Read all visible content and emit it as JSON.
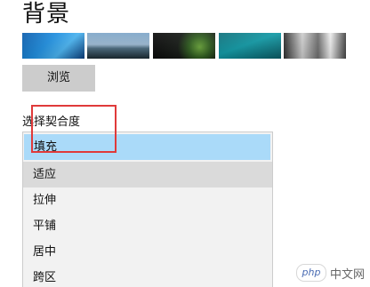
{
  "background_section": {
    "title": "背景",
    "thumbnails": [
      {
        "icon": "wallpaper-thumbnail-blue"
      },
      {
        "icon": "wallpaper-thumbnail-lake"
      },
      {
        "icon": "wallpaper-thumbnail-night"
      },
      {
        "icon": "wallpaper-thumbnail-underwater"
      },
      {
        "icon": "wallpaper-thumbnail-waterfall"
      }
    ],
    "browse_label": "浏览"
  },
  "fit_select": {
    "label": "选择契合度",
    "options": [
      "填充",
      "适应",
      "拉伸",
      "平铺",
      "居中",
      "跨区"
    ],
    "selected": "填充",
    "hovered": "适应",
    "highlight_color": "#e03a3a",
    "selected_color": "#aadaf9"
  },
  "watermark": {
    "logo_text": "php",
    "text": "中文网"
  }
}
